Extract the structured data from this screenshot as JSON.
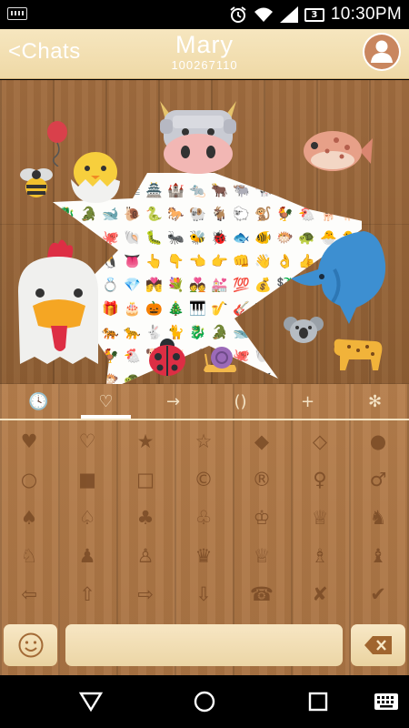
{
  "status_bar": {
    "time": "10:30PM",
    "battery_level": "3",
    "icons": [
      "keyboard-icon",
      "alarm-icon",
      "wifi-icon",
      "signal-icon",
      "battery-icon"
    ]
  },
  "header": {
    "back_label": "<Chats",
    "contact_name": "Mary",
    "contact_id": "100267110",
    "avatar_icon": "person-icon"
  },
  "sticker_emojis": [
    "🎹",
    "🎷",
    "🎸",
    "🎼",
    "🏯",
    "🏰",
    "🐀",
    "🐂",
    "🐃",
    "🐄",
    "🐅",
    "🐆",
    "🐇",
    "🐈",
    "🐉",
    "🐊",
    "🐋",
    "🐌",
    "🐍",
    "🐎",
    "🐏",
    "🐐",
    "🐑",
    "🐒",
    "🐓",
    "🐔",
    "🐕",
    "🐖",
    "🐗",
    "🐘",
    "🐙",
    "🐚",
    "🐛",
    "🐜",
    "🐝",
    "🐞",
    "🐟",
    "🐠",
    "🐡",
    "🐢",
    "🐣",
    "🐤",
    "🐥",
    "🐦",
    "🐧",
    "👅",
    "👆",
    "👇",
    "👈",
    "👉",
    "👊",
    "👋",
    "👌",
    "👍",
    "👎",
    "💊",
    "💋",
    "💌",
    "💍",
    "💎",
    "💏",
    "💐",
    "💑",
    "💒",
    "💯",
    "💰",
    "💱",
    "💲",
    "💳",
    "💴",
    "🔥",
    "🎀",
    "🎁",
    "🎂",
    "🎃",
    "🎄"
  ],
  "keyboard": {
    "tabs": [
      {
        "name": "recent",
        "glyph": "🕓"
      },
      {
        "name": "favorites",
        "glyph": "♡"
      },
      {
        "name": "arrows",
        "glyph": "→"
      },
      {
        "name": "brackets",
        "glyph": "()"
      },
      {
        "name": "math",
        "glyph": "+"
      },
      {
        "name": "symbols",
        "glyph": "✻"
      }
    ],
    "active_tab": 1,
    "symbols": [
      [
        "♥",
        "♡",
        "★",
        "☆",
        "◆",
        "◇",
        "●"
      ],
      [
        "○",
        "■",
        "□",
        "©",
        "®",
        "♀",
        "♂"
      ],
      [
        "♠",
        "♤",
        "♣",
        "♧",
        "♔",
        "♕",
        "♞"
      ],
      [
        "♘",
        "♟",
        "♙",
        "♛",
        "♕",
        "♗",
        "♝"
      ],
      [
        "⇦",
        "⇧",
        "⇨",
        "⇩",
        "☎",
        "✘",
        "✔"
      ]
    ],
    "smiley_key": "☺",
    "delete_key": "⌫",
    "input_placeholder": ""
  },
  "nav_bar": {
    "buttons": [
      "back-icon",
      "home-icon",
      "recents-icon",
      "keyboard-icon"
    ]
  },
  "colors": {
    "header_bg": "#f1ddaf",
    "wood_dark": "#8e5e33",
    "wood_light": "#b57e4c",
    "accent_red": "#e0604a"
  }
}
